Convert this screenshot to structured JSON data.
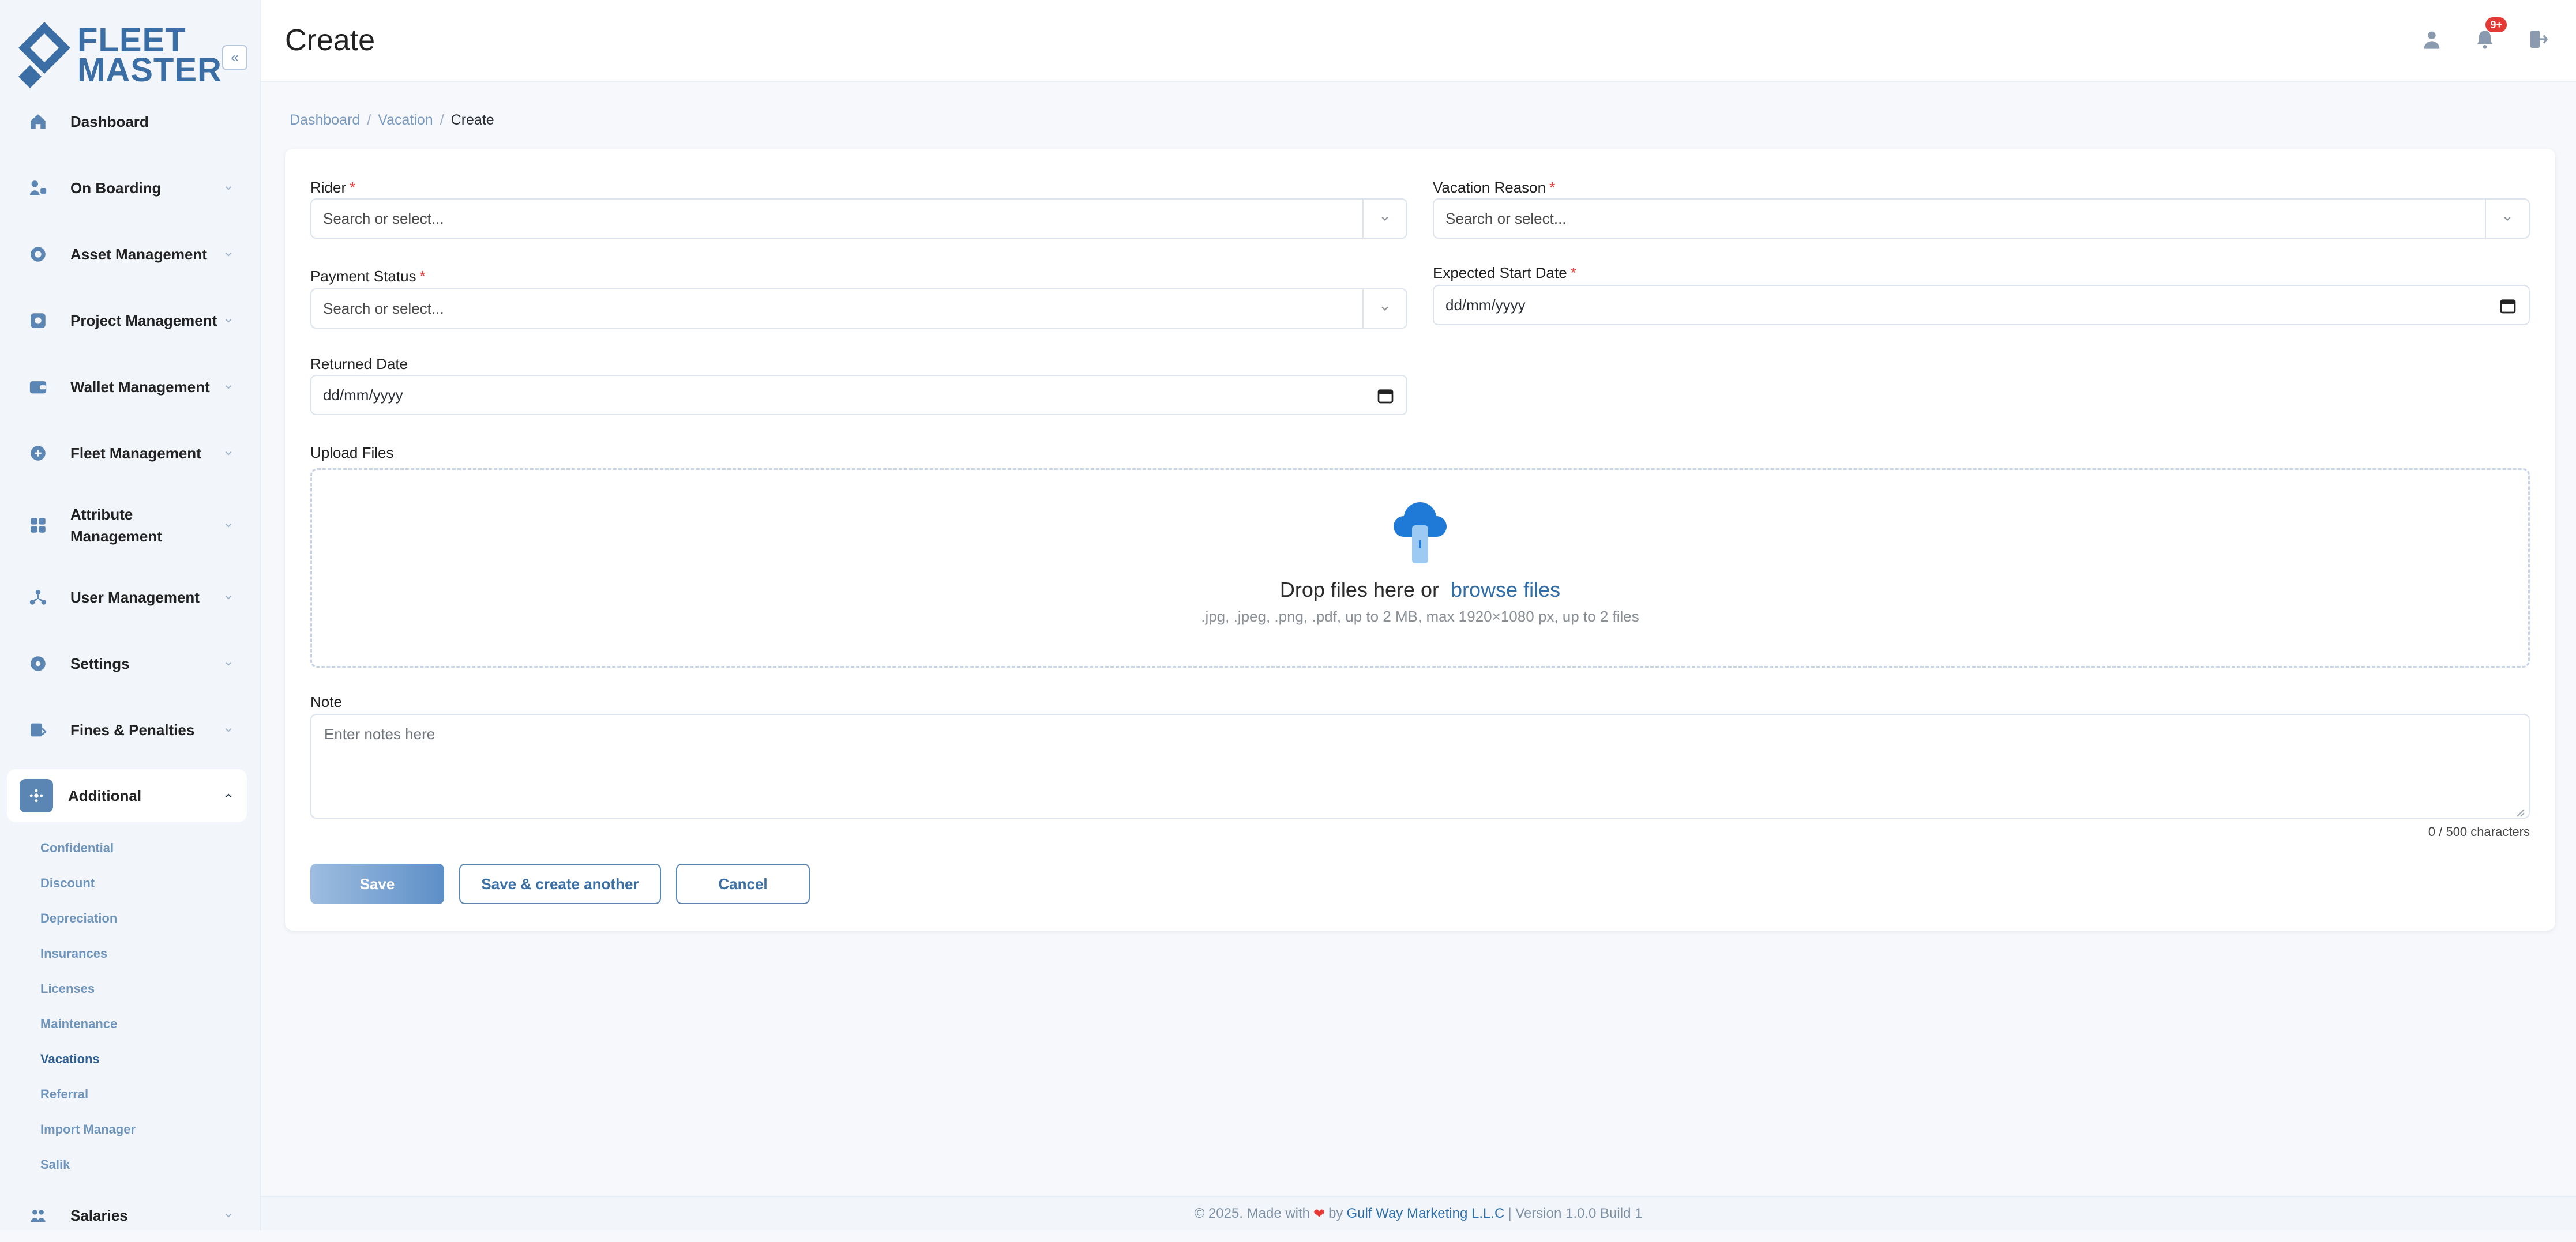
{
  "app": {
    "title_line1": "FLEET",
    "title_line2": "MASTER"
  },
  "header": {
    "title": "Create",
    "notification_count": "9+"
  },
  "breadcrumb": {
    "items": [
      "Dashboard",
      "Vacation",
      "Create"
    ]
  },
  "sidebar": {
    "items": [
      {
        "label": "Dashboard"
      },
      {
        "label": "On Boarding"
      },
      {
        "label": "Asset Management"
      },
      {
        "label": "Project Management"
      },
      {
        "label": "Wallet Management"
      },
      {
        "label": "Fleet Management"
      },
      {
        "label": "Attribute Management"
      },
      {
        "label": "User Management"
      },
      {
        "label": "Settings"
      },
      {
        "label": "Fines & Penalties"
      },
      {
        "label": "Additional"
      },
      {
        "label": "Salaries"
      }
    ],
    "additional_subitems": [
      "Confidential",
      "Discount",
      "Depreciation",
      "Insurances",
      "Licenses",
      "Maintenance",
      "Vacations",
      "Referral",
      "Import Manager",
      "Salik"
    ],
    "active_subitem": "Vacations"
  },
  "form": {
    "rider_label": "Rider",
    "rider_placeholder": "Search or select...",
    "vacation_reason_label": "Vacation Reason",
    "vacation_reason_placeholder": "Search or select...",
    "payment_status_label": "Payment Status",
    "payment_status_placeholder": "Search or select...",
    "expected_start_label": "Expected Start Date",
    "expected_start_value": "dd/mm/yyyy",
    "returned_date_label": "Returned Date",
    "returned_date_value": "dd/mm/yyyy",
    "upload_label": "Upload Files",
    "upload_main": "Drop files here or",
    "upload_browse": "browse files",
    "upload_help": ".jpg, .jpeg, .png, .pdf, up to 2 MB, max 1920×1080 px, up to 2 files",
    "note_label": "Note",
    "note_placeholder": "Enter notes here",
    "char_count": "0 / 500 characters",
    "save_label": "Save",
    "save_create_another_label": "Save & create another",
    "cancel_label": "Cancel"
  },
  "footer": {
    "text_prefix": "© 2025. Made with",
    "text_by": "by",
    "company": "Gulf Way Marketing L.L.C",
    "version": "| Version 1.0.0 Build 1"
  },
  "colors": {
    "primary": "#5b86b3",
    "danger": "#e53935"
  }
}
